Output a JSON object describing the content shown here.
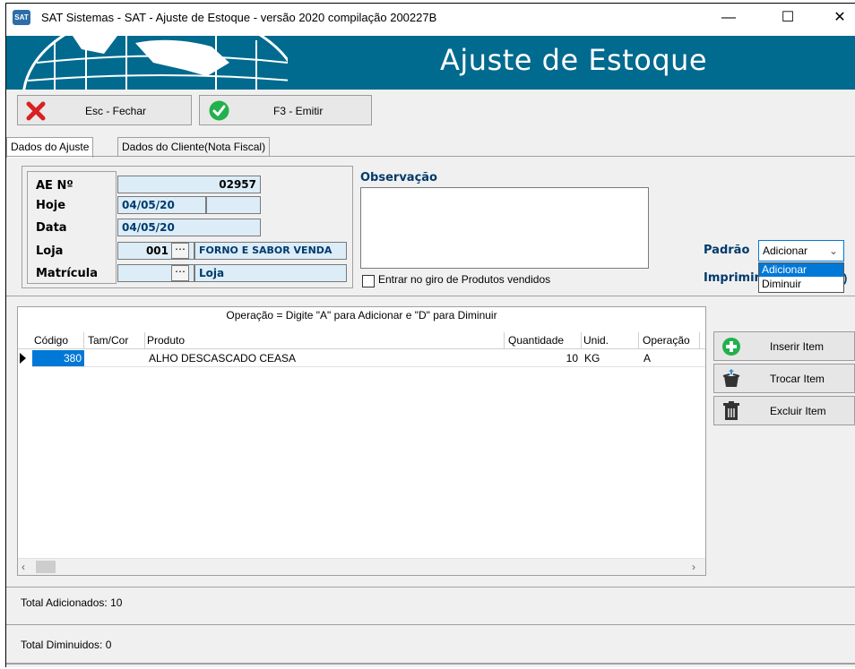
{
  "window": {
    "title": "SAT Sistemas - SAT - Ajuste de Estoque - versão 2020 compilação 200227B",
    "icon": "sat-app-icon",
    "controls": [
      "minimize",
      "maximize",
      "close"
    ]
  },
  "banner": {
    "title": "Ajuste de Estoque",
    "background": "#006a8f"
  },
  "toolbar": {
    "close_label": "Esc - Fechar",
    "emit_label": "F3 - Emitir"
  },
  "tabs": [
    {
      "label": "Dados do Ajuste",
      "active": true
    },
    {
      "label": "Dados do Cliente(Nota Fiscal)",
      "active": false
    }
  ],
  "form": {
    "ae_label": "AE Nº",
    "ae_value": "02957",
    "hoje_label": "Hoje",
    "hoje_value": "04/05/20",
    "data_label": "Data",
    "data_value": "04/05/20",
    "loja_label": "Loja",
    "loja_code": "001",
    "loja_name": "FORNO E SABOR VENDA",
    "matricula_label": "Matrícula",
    "matricula_value": "",
    "matricula_name": "Loja"
  },
  "observation": {
    "label": "Observação",
    "value": "",
    "checkbox_label": "Entrar no giro de Produtos vendidos",
    "checkbox_checked": false
  },
  "padrao": {
    "label": "Padrão",
    "value": "Adicionar",
    "options": [
      "Adicionar",
      "Diminuir"
    ],
    "highlighted": "Adicionar"
  },
  "imprimir": {
    "label": "Imprimir"
  },
  "grid": {
    "caption": "Operação = Digite \"A\" para Adicionar e \"D\" para Diminuir",
    "columns": [
      "Código",
      "Tam/Cor",
      "Produto",
      "Quantidade",
      "Unid.",
      "Operação"
    ],
    "rows": [
      {
        "codigo": "380",
        "tamcor": "",
        "produto": "ALHO DESCASCADO CEASA",
        "quantidade": "10",
        "unid": "KG",
        "operacao": "A"
      }
    ]
  },
  "side_buttons": {
    "insert_label": "Inserir Item",
    "swap_label": "Trocar Item",
    "delete_label": "Excluir Item"
  },
  "totals": {
    "added_label": "Total Adicionados: 10",
    "removed_label": "Total Diminuidos: 0"
  },
  "colors": {
    "accent_label": "#003a6b",
    "field_bg": "#dcedf8",
    "selection": "#0078d7"
  }
}
